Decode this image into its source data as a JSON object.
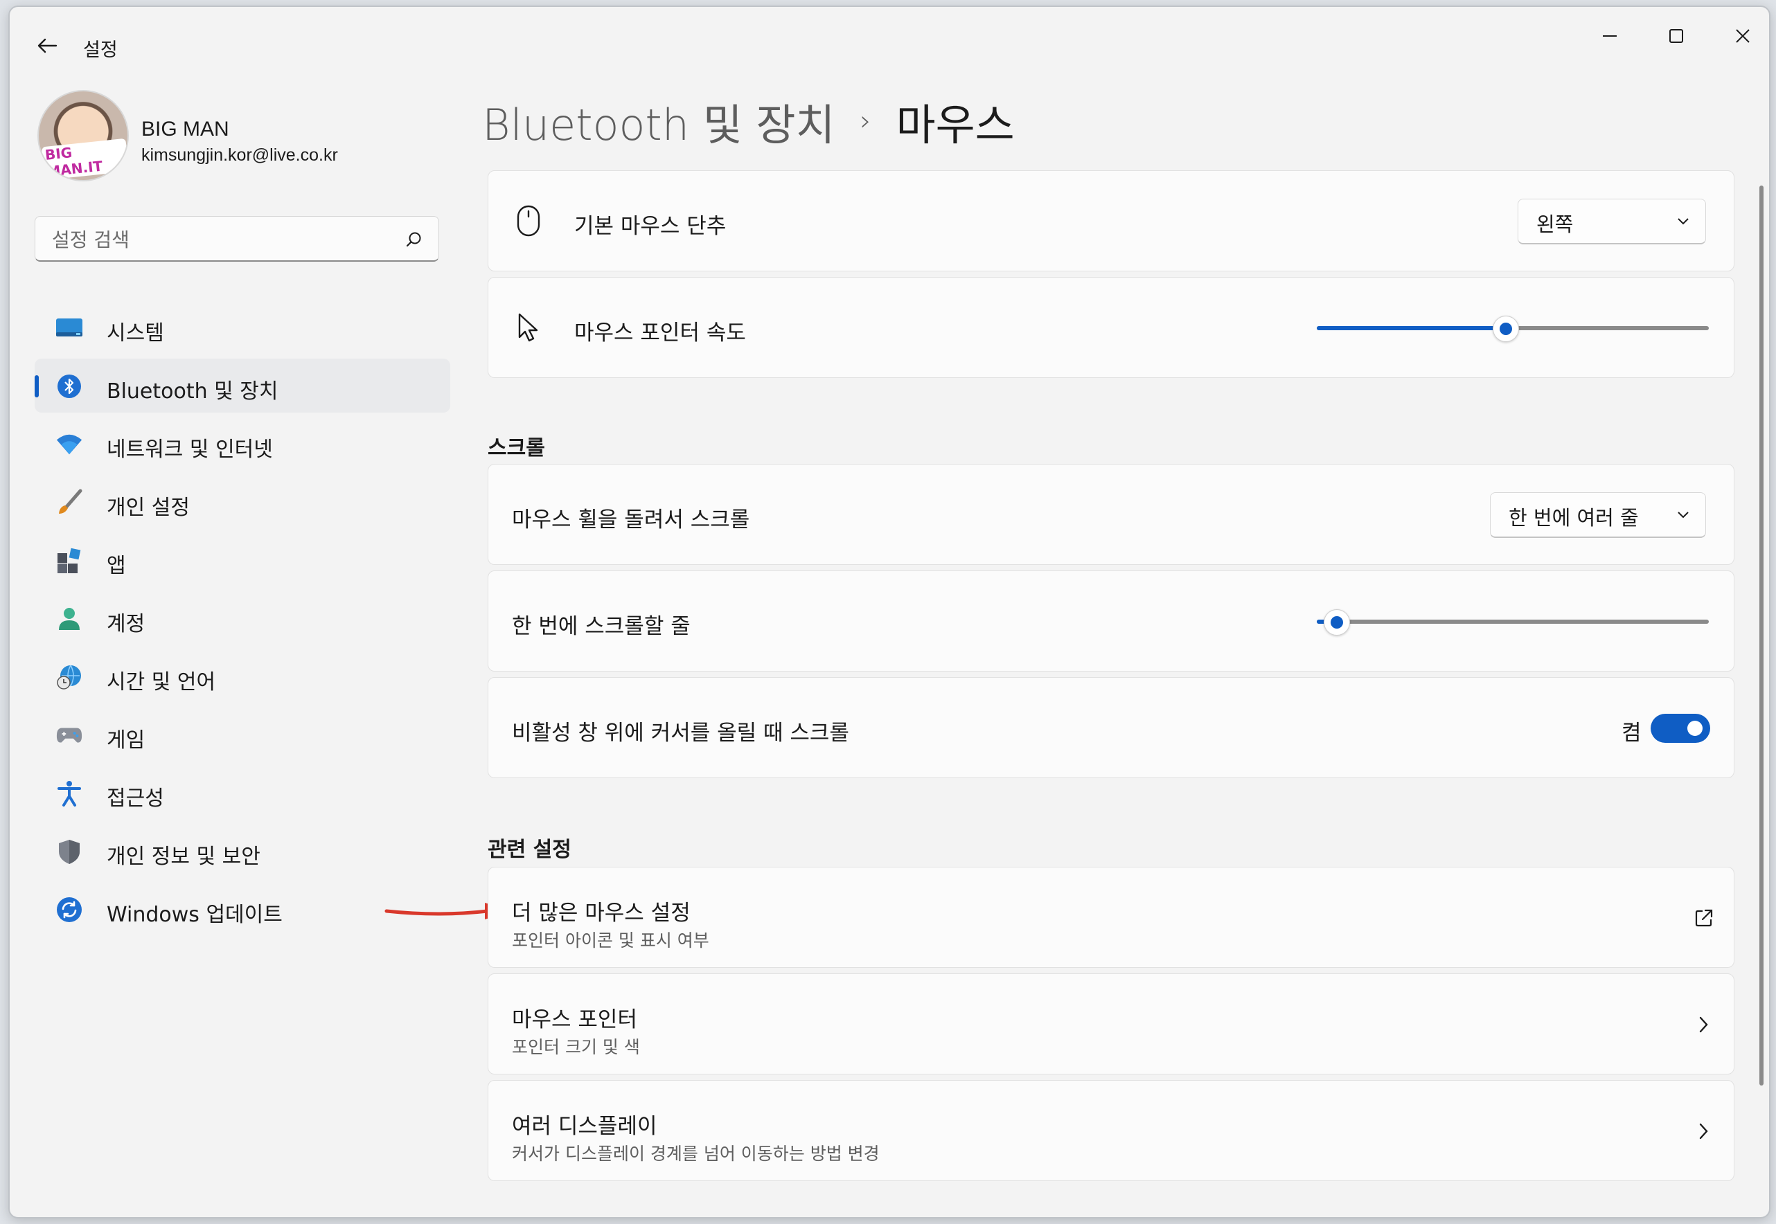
{
  "window": {
    "app_title": "설정",
    "controls": [
      "minimize",
      "maximize",
      "close"
    ]
  },
  "user": {
    "name": "BIG MAN",
    "email": "kimsungjin.kor@live.co.kr",
    "avatar_badge": "BIG MAN.IT"
  },
  "search": {
    "placeholder": "설정 검색",
    "value": ""
  },
  "sidebar": {
    "items": [
      {
        "label": "시스템",
        "icon": "system-icon",
        "active": false
      },
      {
        "label": "Bluetooth 및 장치",
        "icon": "bluetooth-icon",
        "active": true
      },
      {
        "label": "네트워크 및 인터넷",
        "icon": "wifi-icon",
        "active": false
      },
      {
        "label": "개인 설정",
        "icon": "brush-icon",
        "active": false
      },
      {
        "label": "앱",
        "icon": "apps-icon",
        "active": false
      },
      {
        "label": "계정",
        "icon": "account-icon",
        "active": false
      },
      {
        "label": "시간 및 언어",
        "icon": "globe-clock-icon",
        "active": false
      },
      {
        "label": "게임",
        "icon": "gamepad-icon",
        "active": false
      },
      {
        "label": "접근성",
        "icon": "accessibility-icon",
        "active": false
      },
      {
        "label": "개인 정보 및 보안",
        "icon": "shield-icon",
        "active": false
      },
      {
        "label": "Windows 업데이트",
        "icon": "update-icon",
        "active": false
      }
    ]
  },
  "header": {
    "parent": "Bluetooth 및 장치",
    "separator": "›",
    "current": "마우스"
  },
  "main": {
    "primary_button": {
      "label": "기본 마우스 단추",
      "value": "왼쪽"
    },
    "pointer_speed": {
      "label": "마우스 포인터 속도",
      "value_fraction": 0.48
    },
    "scroll_section": "스크롤",
    "wheel_scroll": {
      "label": "마우스 휠을 돌려서 스크롤",
      "value": "한 번에 여러 줄"
    },
    "lines_per_scroll": {
      "label": "한 번에 스크롤할 줄",
      "value_fraction": 0.05
    },
    "inactive_scroll": {
      "label": "비활성 창 위에 커서를 올릴 때 스크롤",
      "state_label": "켬",
      "on": true
    },
    "related_section": "관련 설정",
    "related": [
      {
        "title": "더 많은 마우스 설정",
        "subtitle": "포인터 아이콘 및 표시 여부",
        "icon": "external-link-icon"
      },
      {
        "title": "마우스 포인터",
        "subtitle": "포인터 크기 및 색",
        "icon": "chevron-right-icon"
      },
      {
        "title": "여러 디스플레이",
        "subtitle": "커서가 디스플레이 경계를 넘어 이동하는 방법 변경",
        "icon": "chevron-right-icon"
      }
    ]
  },
  "colors": {
    "accent": "#0f5dc4",
    "annotation_arrow": "#d9382b",
    "background": "#f3f3f3",
    "card": "#fbfbfb"
  }
}
